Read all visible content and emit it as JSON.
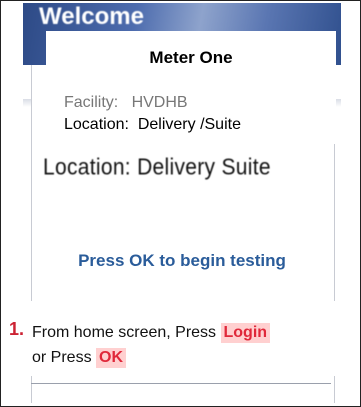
{
  "screen": {
    "header_title": "Welcome",
    "location_text": "Location: Delivery Suite",
    "prompt": "Press OK to begin testing"
  },
  "card": {
    "title": "Meter One",
    "facility": "Facility:   HVDHB",
    "location": "Location:  Delivery /Suite"
  },
  "instruction": {
    "number": "1.",
    "text_before": "From home screen, Press ",
    "login_key": "Login",
    "text_middle": "or Press ",
    "ok_key": "OK"
  },
  "colors": {
    "header_blue": "#3a5a9c",
    "prompt_blue": "#2a5c9a",
    "key_red": "#e0283a",
    "key_highlight": "#ffd0d0",
    "step_number_red": "#cc2233"
  }
}
